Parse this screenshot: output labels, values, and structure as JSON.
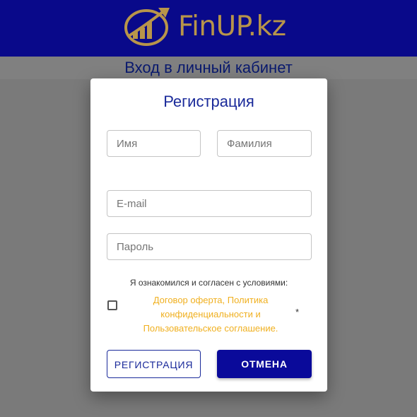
{
  "header": {
    "brand": "FinUP.kz",
    "subtitle": "Вход в личный кабинет",
    "colors": {
      "background": "#09098a",
      "brand": "#b8954a"
    }
  },
  "modal": {
    "title": "Регистрация",
    "fields": {
      "first_name": {
        "placeholder": "Имя",
        "value": ""
      },
      "last_name": {
        "placeholder": "Фамилия",
        "value": ""
      },
      "email": {
        "placeholder": "E-mail",
        "value": ""
      },
      "password": {
        "placeholder": "Пароль",
        "value": ""
      }
    },
    "terms": {
      "label": "Я ознакомился и согласен с условиями:",
      "checked": false,
      "links": [
        "Договор оферта, Политика",
        "конфиденциальности и",
        "Пользовательское соглашение."
      ],
      "required_mark": "*"
    },
    "buttons": {
      "register": "РЕГИСТРАЦИЯ",
      "cancel": "ОТМЕНА"
    },
    "colors": {
      "title": "#1a2a9a",
      "link": "#f0b020",
      "primary_button": "#0a0a9a"
    }
  }
}
